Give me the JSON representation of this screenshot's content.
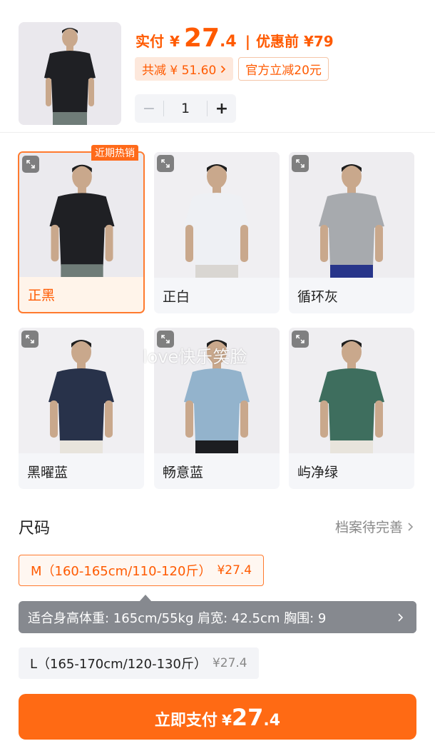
{
  "product": {
    "thumbnail_alt": "黑色T恤模特",
    "paid_label": "实付",
    "currency": "¥",
    "price_int": "27",
    "price_dec": ".4",
    "divider": "|",
    "original_label": "优惠前 ¥79",
    "discount_chip": "共减 ¥ 51.60",
    "coupon_chip": "官方立减20元",
    "quantity": "1",
    "minus": "−",
    "plus": "+"
  },
  "colors": {
    "hot_tag": "近期热销",
    "items": [
      {
        "label": "正黑",
        "shirt": "#1f2024",
        "pants": "#6f7c78",
        "bg": "#ebeaee"
      },
      {
        "label": "正白",
        "shirt": "#eef0f4",
        "pants": "#d9d6d2",
        "bg": "#f0eff2"
      },
      {
        "label": "循环灰",
        "shirt": "#a7aaae",
        "pants": "#27358a",
        "bg": "#eeedf0"
      },
      {
        "label": "黑曜蓝",
        "shirt": "#28324a",
        "pants": "#e8e4dc",
        "bg": "#f0eff2"
      },
      {
        "label": "畅意蓝",
        "shirt": "#93b3cc",
        "pants": "#1c1d21",
        "bg": "#eeedf0"
      },
      {
        "label": "屿净绿",
        "shirt": "#3e6e5e",
        "pants": "#e8e4dc",
        "bg": "#efeef1"
      }
    ]
  },
  "watermark": "love快乐笑脸",
  "size": {
    "title": "尺码",
    "profile_link": "档案待完善",
    "options": [
      {
        "label": "M（160-165cm/110-120斤）",
        "price": "¥27.4"
      },
      {
        "label": "L（165-170cm/120-130斤）",
        "price": "¥27.4"
      }
    ],
    "fit_info": "适合身高体重: 165cm/55kg    肩宽: 42.5cm    胸围: 9"
  },
  "pay": {
    "label": "立即支付",
    "currency": "¥",
    "price_int": "27",
    "price_dec": ".4"
  },
  "theme": {
    "accent": "#ff5a00",
    "button": "#ff6a14"
  }
}
